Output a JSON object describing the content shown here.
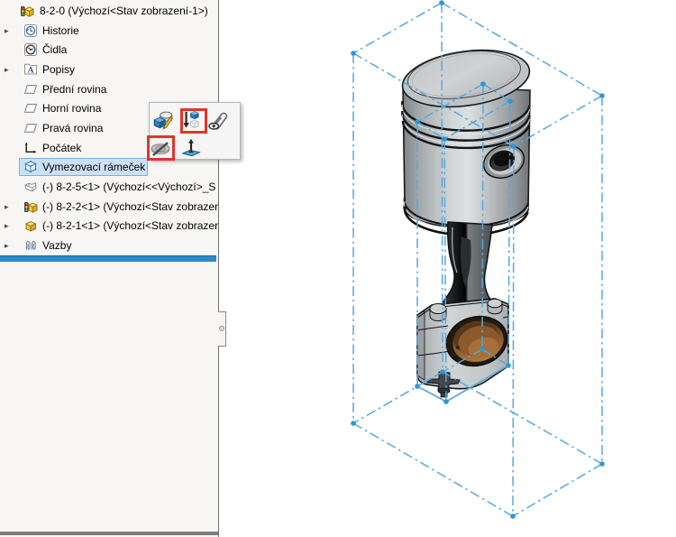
{
  "panel": {
    "tree": {
      "items": [
        {
          "id": "assembly-root",
          "label": "8-2-0 (Výchozí<Stav zobrazení-1>)",
          "icon": "assembly-icon",
          "arrow": false,
          "selected": false
        },
        {
          "id": "history",
          "label": "Historie",
          "icon": "history-icon",
          "arrow": true,
          "selected": false
        },
        {
          "id": "sensors",
          "label": "Čidla",
          "icon": "sensors-icon",
          "arrow": false,
          "selected": false
        },
        {
          "id": "annotations",
          "label": "Popisy",
          "icon": "annotations-icon",
          "arrow": true,
          "selected": false
        },
        {
          "id": "front-plane",
          "label": "Přední rovina",
          "icon": "plane-icon",
          "arrow": false,
          "selected": false
        },
        {
          "id": "top-plane",
          "label": "Horní rovina",
          "icon": "plane-icon",
          "arrow": false,
          "selected": false
        },
        {
          "id": "right-plane",
          "label": "Pravá rovina",
          "icon": "plane-icon",
          "arrow": false,
          "selected": false
        },
        {
          "id": "origin",
          "label": "Počátek",
          "icon": "origin-icon",
          "arrow": false,
          "selected": false
        },
        {
          "id": "bounding-box",
          "label": "Vymezovací rámeček",
          "icon": "bounding-box-icon",
          "arrow": false,
          "selected": true
        },
        {
          "id": "component-8-2-5",
          "label": "(-) 8-2-5<1> (Výchozí<<Výchozí>_S",
          "icon": "part-gray-icon",
          "arrow": false,
          "selected": false
        },
        {
          "id": "component-8-2-2",
          "label": "(-) 8-2-2<1> (Výchozí<Stav zobrazen",
          "icon": "assembly-icon",
          "arrow": true,
          "selected": false
        },
        {
          "id": "component-8-2-1",
          "label": "(-) 8-2-1<1> (Výchozí<Stav zobrazen",
          "icon": "part-yellow-icon",
          "arrow": true,
          "selected": false
        },
        {
          "id": "mates",
          "label": "Vazby",
          "icon": "mates-icon",
          "arrow": true,
          "selected": false
        }
      ]
    }
  },
  "context_toolbar": {
    "buttons": [
      {
        "id": "edit-feature",
        "icon": "edit-feature-icon",
        "highlighted": false
      },
      {
        "id": "move-down-cube",
        "icon": "move-down-cube-icon",
        "highlighted": true
      },
      {
        "id": "view-mates",
        "icon": "view-mates-icon",
        "highlighted": false
      },
      {
        "id": "hide",
        "icon": "hide-icon",
        "highlighted": true
      },
      {
        "id": "normal-to-plane",
        "icon": "normal-plane-icon",
        "highlighted": false
      }
    ]
  },
  "colors": {
    "rollback_blue": "#2f8ac5",
    "bounding_box_blue": "#58a8de",
    "bounding_box_dot": "#2f97d8",
    "selection_fill": "#cbe0f6",
    "selection_border": "#7fafd8",
    "highlight_red": "#e0352b",
    "panel_bg": "#f7f6f5"
  }
}
